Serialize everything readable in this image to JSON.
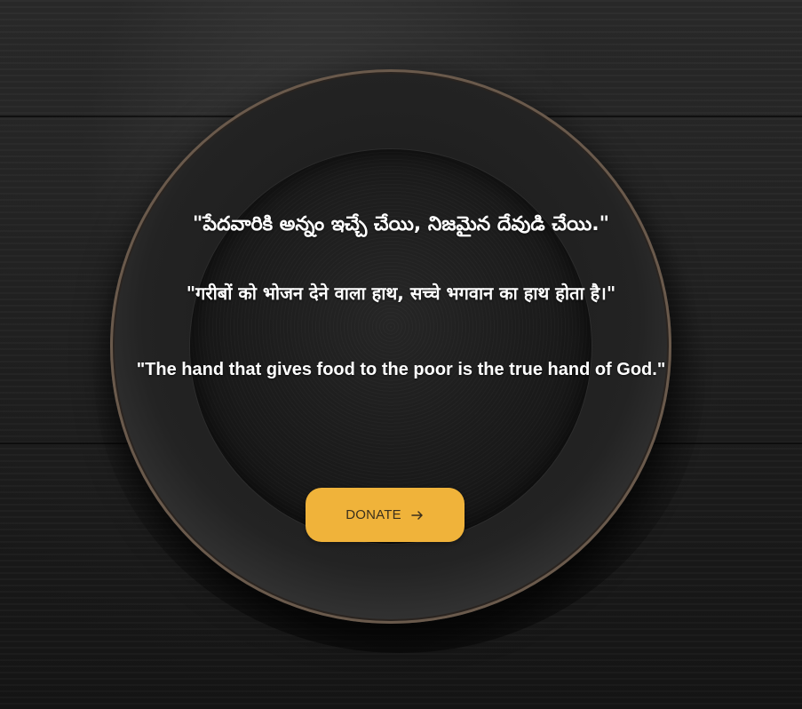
{
  "quotes": {
    "telugu": "\"పేదవారికి అన్నం ఇచ్చే చేయి, నిజమైన దేవుడి చేయి.\"",
    "hindi": "\"गरीबों को भोजन देने वाला हाथ, सच्चे भगवान का हाथ होता है।\"",
    "english": "\"The hand that gives food to the poor is the true hand of God.\""
  },
  "donate": {
    "label": "DONATE",
    "icon": "arrow-right-icon"
  },
  "colors": {
    "button_background": "#f0b33a",
    "button_text": "#3a2f1c",
    "quote_text": "#ffffff",
    "background": "#1e1e1e"
  }
}
